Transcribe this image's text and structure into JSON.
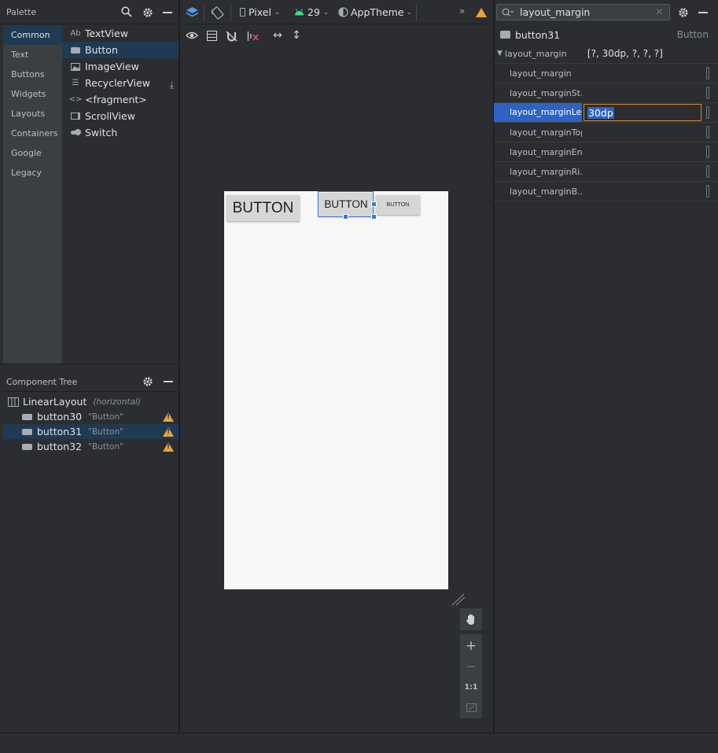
{
  "palette": {
    "title": "Palette",
    "categories": [
      "Common",
      "Text",
      "Buttons",
      "Widgets",
      "Layouts",
      "Containers",
      "Google",
      "Legacy"
    ],
    "selected_category": "Common",
    "items": [
      {
        "icon": "textview-icon",
        "label": "TextView"
      },
      {
        "icon": "button-icon",
        "label": "Button"
      },
      {
        "icon": "image-icon",
        "label": "ImageView"
      },
      {
        "icon": "list-icon",
        "label": "RecyclerView"
      },
      {
        "icon": "code-icon",
        "label": "<fragment>"
      },
      {
        "icon": "scroll-icon",
        "label": "ScrollView"
      },
      {
        "icon": "switch-icon",
        "label": "Switch"
      }
    ],
    "selected_item": "Button"
  },
  "toolbar": {
    "device": "Pixel",
    "api": "29",
    "theme": "AppTheme",
    "overflow": "»"
  },
  "component_tree": {
    "title": "Component Tree",
    "root": {
      "label": "LinearLayout",
      "sub": "(horizontal)"
    },
    "children": [
      {
        "id": "button30",
        "text": "\"Button\"",
        "warning": true
      },
      {
        "id": "button31",
        "text": "\"Button\"",
        "warning": true
      },
      {
        "id": "button32",
        "text": "\"Button\"",
        "warning": true
      }
    ],
    "selected": "button31"
  },
  "device_preview": {
    "buttons": [
      "BUTTON",
      "BUTTON",
      "BUTTON"
    ]
  },
  "attributes": {
    "search_value": "layout_margin",
    "component_name": "button31",
    "component_type": "Button",
    "group": {
      "label": "layout_margin",
      "value": "[?, 30dp, ?, ?, ?]"
    },
    "rows": [
      {
        "name": "layout_margin",
        "value": ""
      },
      {
        "name": "layout_marginSt...",
        "value": ""
      },
      {
        "name": "layout_marginLeft",
        "value": "30dp"
      },
      {
        "name": "layout_marginTop",
        "value": ""
      },
      {
        "name": "layout_marginEnd",
        "value": ""
      },
      {
        "name": "layout_marginRi...",
        "value": ""
      },
      {
        "name": "layout_marginB...",
        "value": ""
      }
    ],
    "selected_row": "layout_marginLeft"
  },
  "zoom": {
    "one_to_one": "1:1",
    "plus": "+",
    "minus": "−"
  },
  "colors": {
    "selection": "#1f3a52",
    "highlight": "#2e63c4",
    "warning": "#e8a33d",
    "focus_border": "#d9892b"
  }
}
